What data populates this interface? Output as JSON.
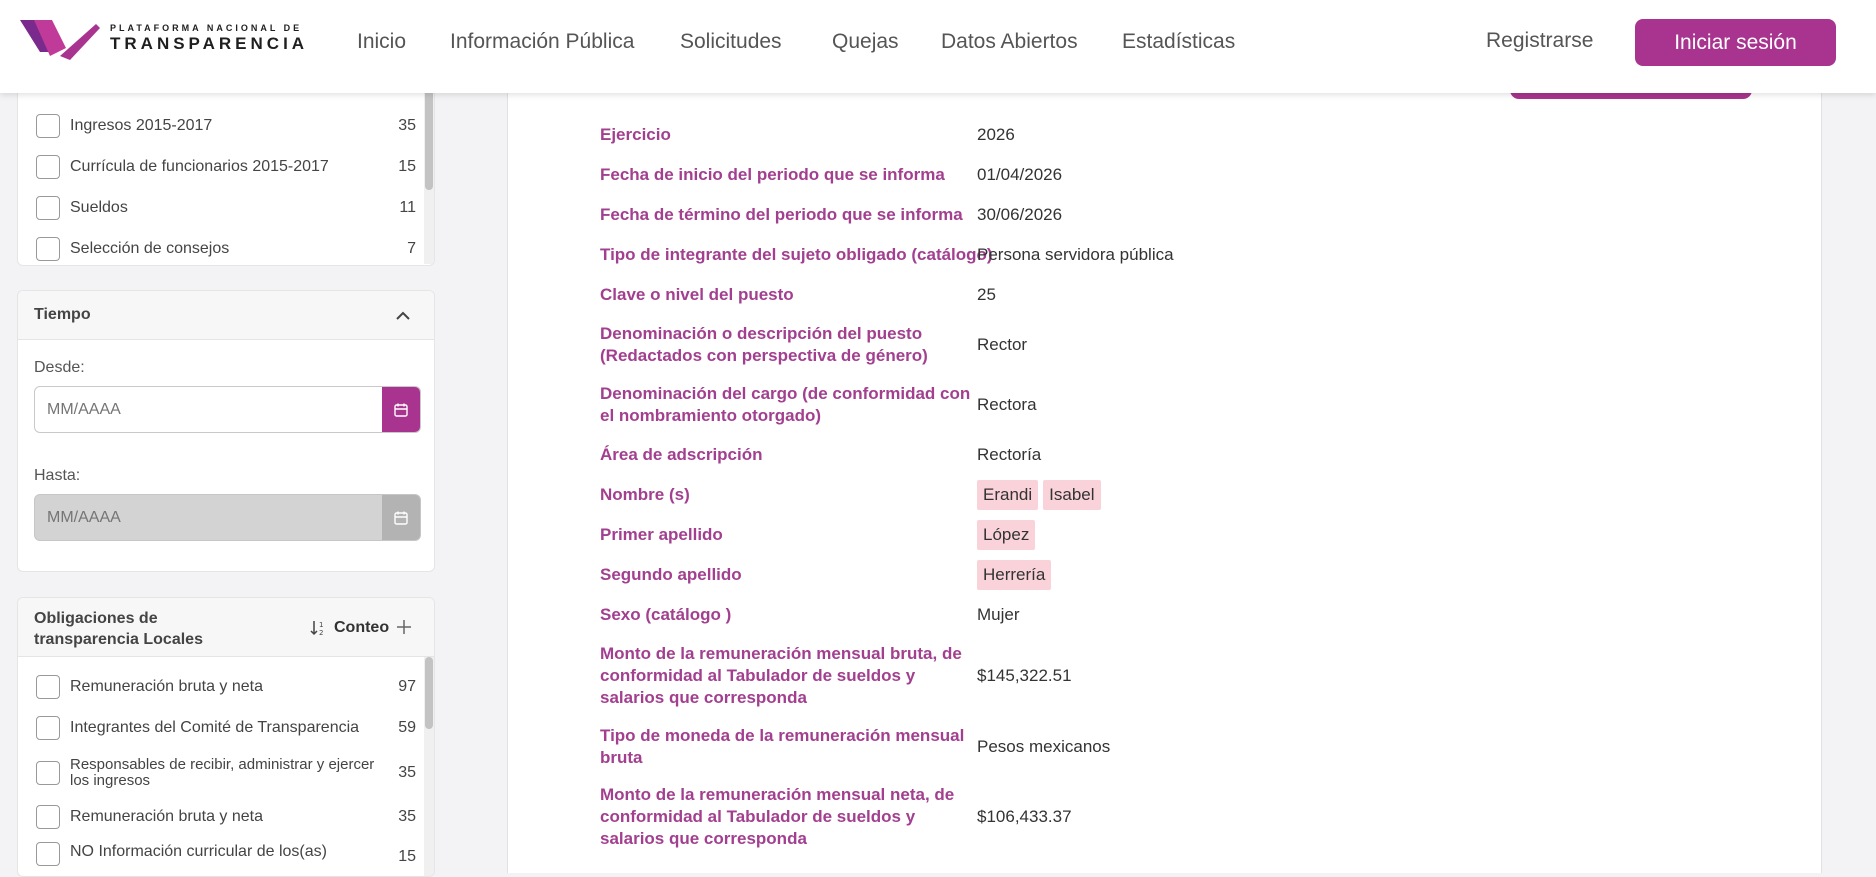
{
  "header": {
    "logo_line1": "PLATAFORMA NACIONAL DE",
    "logo_line2": "TRANSPARENCIA",
    "nav": [
      "Inicio",
      "Información Pública",
      "Solicitudes",
      "Quejas",
      "Datos Abiertos",
      "Estadísticas"
    ],
    "register": "Registrarse",
    "login": "Iniciar sesión",
    "brand_color": "#a8348f"
  },
  "top_filters": {
    "items": [
      {
        "label": "Ingresos 2015-2017",
        "count": "35"
      },
      {
        "label": "Currícula de funcionarios 2015-2017",
        "count": "15"
      },
      {
        "label": "Sueldos",
        "count": "11"
      },
      {
        "label": "Selección de consejos",
        "count": "7"
      }
    ]
  },
  "tiempo": {
    "title": "Tiempo",
    "from_label": "Desde:",
    "from_placeholder": "MM/AAAA",
    "to_label": "Hasta:",
    "to_placeholder": "MM/AAAA"
  },
  "obligaciones": {
    "title": "Obligaciones de transparencia Locales",
    "sort_label": "Conteo",
    "items": [
      {
        "label": "Remuneración bruta y neta",
        "count": "97"
      },
      {
        "label": "Integrantes del Comité de Transparencia",
        "count": "59"
      },
      {
        "label": "Responsables de recibir, administrar y ejercer los ingresos",
        "count": "35"
      },
      {
        "label": "Remuneración bruta y neta",
        "count": "35"
      },
      {
        "label": "NO Información curricular de los(as)",
        "count": "15"
      }
    ]
  },
  "record": {
    "fields": [
      {
        "label": "Ejercicio",
        "value": "2026"
      },
      {
        "label": "Fecha de inicio del periodo que se informa",
        "value": "01/04/2026"
      },
      {
        "label": "Fecha de término del periodo que se informa",
        "value": "30/06/2026"
      },
      {
        "label": "Tipo de integrante del sujeto obligado (catálogo)",
        "value": "Persona servidora pública"
      },
      {
        "label": "Clave o nivel del puesto",
        "value": "25"
      },
      {
        "label": "Denominación o descripción del puesto (Redactados con perspectiva de género)",
        "value": "Rector"
      },
      {
        "label": "Denominación del cargo (de conformidad con el nombramiento otorgado)",
        "value": "Rectora"
      },
      {
        "label": "Área de adscripción",
        "value": "Rectoría"
      },
      {
        "label": "Nombre (s)",
        "chips": [
          "Erandi",
          "Isabel"
        ]
      },
      {
        "label": "Primer apellido",
        "chips": [
          "López"
        ]
      },
      {
        "label": "Segundo apellido",
        "chips": [
          "Herrería"
        ]
      },
      {
        "label": "Sexo (catálogo )",
        "value": "Mujer"
      },
      {
        "label": "Monto de la remuneración mensual bruta, de conformidad al Tabulador de sueldos y salarios que corresponda",
        "value": "$145,322.51"
      },
      {
        "label": "Tipo de moneda de la remuneración mensual bruta",
        "value": "Pesos mexicanos"
      },
      {
        "label": "Monto de la remuneración mensual neta, de conformidad al Tabulador de sueldos y salarios que corresponda",
        "value": "$106,433.37"
      }
    ]
  }
}
